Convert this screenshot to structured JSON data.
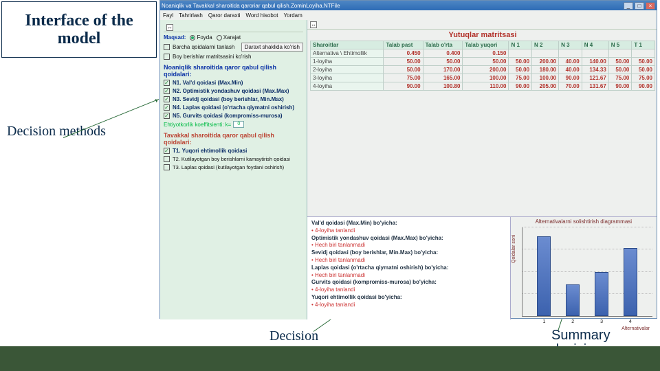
{
  "slide": {
    "title": "Interface of the model",
    "label_methods": "Decision methods",
    "label_decision": "Decision",
    "label_summary_l1": "Summary",
    "label_summary_l2": "decisions"
  },
  "window": {
    "title": "Noaniqlik va Tavakkal sharoitida qaroriar qabul qilish.ZominLoyiha.NTFile",
    "menu": [
      "Fayl",
      "Tahrirlash",
      "Qaror darахti",
      "Word hisobot",
      "Yordam"
    ],
    "btn_min": "_",
    "btn_max": "□",
    "btn_close": "×"
  },
  "goal": {
    "label": "Maqsad:",
    "opt1": "Foyda",
    "opt2": "Xarajat"
  },
  "left": {
    "chk_all": "Barcha qoidalarni tanlash",
    "btn_tree": "Daraxt shaklida ko'rish",
    "chk_matrix": "Boy berishlar matritsasini ko'rish",
    "sect_n": "Noaniqlik sharoitida qaror qabul qilish qoidalari:",
    "n1": "N1. Val'd qoidasi (Max.Min)",
    "n2": "N2. Optimistik yondashuv qoidasi (Max.Max)",
    "n3": "N3. Sevidj qoidasi (boy berishlar, Min.Max)",
    "n4": "N4. Laplas qoidasi (o'rtacha qiymatni oshirish)",
    "n5": "N5. Gurvits qoidasi (kompromiss-murosa)",
    "coef_label": "Ehtiyotkorlik koeffitsienti: k=",
    "coef_value": "0",
    "sect_t": "Tavakkal sharoitida qaror qabul qilish qoidalari:",
    "t1": "T1. Yuqori ehtimollik qoidasi",
    "t2": "T2. Kutilayotgan boy berishlarni kamaytirish qoidasi",
    "t3": "T3. Laplas qoidasi (kutilayotgan foydani oshirish)"
  },
  "matrix": {
    "title": "Yutuqlar matritsasi",
    "headers": [
      "Sharoitlar",
      "Talab past",
      "Talab o'rta",
      "Talab yuqori",
      "N 1",
      "N 2",
      "N 3",
      "N 4",
      "N 5",
      "T 1"
    ],
    "rows": [
      {
        "label": "Alternativa \\ Ehtimollik",
        "c": [
          "0.450",
          "0.400",
          "0.150",
          "",
          "",
          "",
          "",
          "",
          ""
        ]
      },
      {
        "label": "1-loyiha",
        "c": [
          "50.00",
          "50.00",
          "50.00",
          "50.00",
          "200.00",
          "40.00",
          "140.00",
          "50.00",
          "50.00"
        ]
      },
      {
        "label": "2-loyiha",
        "c": [
          "50.00",
          "170.00",
          "200.00",
          "50.00",
          "180.00",
          "40.00",
          "134.33",
          "50.00",
          "50.00"
        ]
      },
      {
        "label": "3-loyiha",
        "c": [
          "75.00",
          "165.00",
          "100.00",
          "75.00",
          "100.00",
          "90.00",
          "121.67",
          "75.00",
          "75.00"
        ]
      },
      {
        "label": "4-loyiha",
        "c": [
          "90.00",
          "100.80",
          "110.00",
          "90.00",
          "205.00",
          "70.00",
          "131.67",
          "90.00",
          "90.00"
        ]
      }
    ]
  },
  "results": {
    "lines": [
      {
        "h": "Val'd qoidasi (Max.Min) bo'yicha:",
        "b": "4-loyiha tanlandi"
      },
      {
        "h": "Optimistik yondashuv qoidasi (Max.Max) bo'yicha:",
        "b": "Hech biri tanlanmadi"
      },
      {
        "h": "Sevidj qoidasi (boy berishlar, Min.Max) bo'yicha:",
        "b": "Hech biri tanlanmadi"
      },
      {
        "h": "Laplas qoidasi (o'rtacha qiymatni oshirish) bo'yicha:",
        "b": "Hech biri tanlanmadi"
      },
      {
        "h": "Gurvits qoidasi (kompromiss-murosa) bo'yicha:",
        "b": "4-loyiha tanlandi"
      },
      {
        "h": "Yuqori ehtimollik qoidasi bo'yicha:",
        "b": "4-loyiha tanlandi"
      }
    ]
  },
  "chart_data": {
    "type": "bar",
    "title": "Alternativalarni solishtirish diagrammasi",
    "categories": [
      "1",
      "2",
      "3",
      "4"
    ],
    "values": [
      1.0,
      0.4,
      0.55,
      0.85
    ],
    "xlabel": "Alternativalar",
    "ylabel": "Qoidalar soni",
    "ylim": [
      0,
      1
    ]
  },
  "icons": {
    "explore": "↔"
  }
}
